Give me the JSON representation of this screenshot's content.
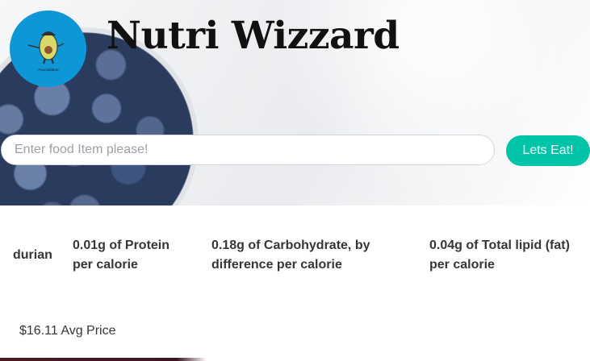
{
  "header": {
    "title": "Nutri Wizzard",
    "logo_text": "Avocadabra!",
    "logo_icon": "avocado-wizard-icon"
  },
  "search": {
    "placeholder": "Enter food Item please!",
    "value": "",
    "button_label": "Lets Eat!"
  },
  "result": {
    "food_name": "durian",
    "nutrients": [
      "0.01g of Protein per calorie",
      "0.18g of Carbohydrate, by difference per calorie",
      "0.04g of Total lipid (fat) per calorie"
    ],
    "price_text": "$16.11 Avg Price"
  },
  "colors": {
    "accent": "#00c4a7",
    "logo_bg": "#0e97d6",
    "text": "#363636"
  }
}
